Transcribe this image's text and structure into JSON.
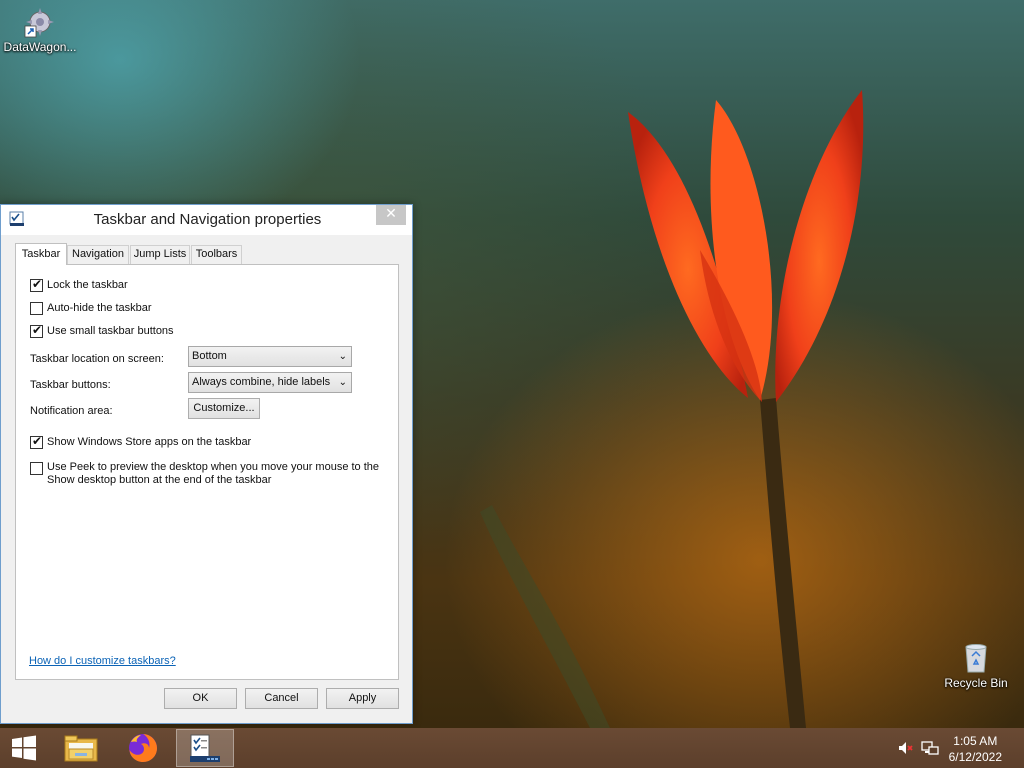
{
  "desktop": {
    "icons": [
      {
        "label": "DataWagon..."
      },
      {
        "label": "Recycle Bin"
      }
    ]
  },
  "dialog": {
    "title": "Taskbar and Navigation properties",
    "close_glyph": "✕",
    "tabs": [
      {
        "label": "Taskbar",
        "active": true
      },
      {
        "label": "Navigation",
        "active": false
      },
      {
        "label": "Jump Lists",
        "active": false
      },
      {
        "label": "Toolbars",
        "active": false
      }
    ],
    "checkboxes": [
      {
        "label": "Lock the taskbar",
        "checked": true
      },
      {
        "label": "Auto-hide the taskbar",
        "checked": false
      },
      {
        "label": "Use small taskbar buttons",
        "checked": true
      },
      {
        "label": "Show Windows Store apps on the taskbar",
        "checked": true
      },
      {
        "label": "Use Peek to preview the desktop when you move your mouse to the Show desktop button at the end of the taskbar",
        "checked": false
      }
    ],
    "location_label": "Taskbar location on screen:",
    "location_value": "Bottom",
    "buttons_label": "Taskbar buttons:",
    "buttons_value": "Always combine, hide labels",
    "notification_label": "Notification area:",
    "customize_label": "Customize...",
    "help_link": "How do I customize taskbars?",
    "ok_label": "OK",
    "cancel_label": "Cancel",
    "apply_label": "Apply"
  },
  "taskbar": {
    "items": [
      {
        "icon": "windows-start-icon"
      },
      {
        "icon": "file-explorer-icon"
      },
      {
        "icon": "firefox-icon"
      },
      {
        "icon": "taskbar-properties-icon",
        "active": true
      }
    ],
    "tray": {
      "volume_icon": "volume-muted-icon",
      "network_icon": "network-icon"
    },
    "time": "1:05 AM",
    "date": "6/12/2022"
  }
}
